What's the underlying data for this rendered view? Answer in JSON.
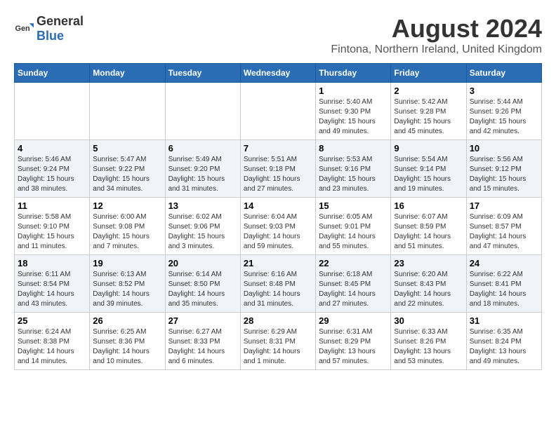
{
  "header": {
    "logo_general": "General",
    "logo_blue": "Blue",
    "main_title": "August 2024",
    "subtitle": "Fintona, Northern Ireland, United Kingdom"
  },
  "days_of_week": [
    "Sunday",
    "Monday",
    "Tuesday",
    "Wednesday",
    "Thursday",
    "Friday",
    "Saturday"
  ],
  "weeks": [
    [
      {
        "day": "",
        "info": ""
      },
      {
        "day": "",
        "info": ""
      },
      {
        "day": "",
        "info": ""
      },
      {
        "day": "",
        "info": ""
      },
      {
        "day": "1",
        "info": "Sunrise: 5:40 AM\nSunset: 9:30 PM\nDaylight: 15 hours\nand 49 minutes."
      },
      {
        "day": "2",
        "info": "Sunrise: 5:42 AM\nSunset: 9:28 PM\nDaylight: 15 hours\nand 45 minutes."
      },
      {
        "day": "3",
        "info": "Sunrise: 5:44 AM\nSunset: 9:26 PM\nDaylight: 15 hours\nand 42 minutes."
      }
    ],
    [
      {
        "day": "4",
        "info": "Sunrise: 5:46 AM\nSunset: 9:24 PM\nDaylight: 15 hours\nand 38 minutes."
      },
      {
        "day": "5",
        "info": "Sunrise: 5:47 AM\nSunset: 9:22 PM\nDaylight: 15 hours\nand 34 minutes."
      },
      {
        "day": "6",
        "info": "Sunrise: 5:49 AM\nSunset: 9:20 PM\nDaylight: 15 hours\nand 31 minutes."
      },
      {
        "day": "7",
        "info": "Sunrise: 5:51 AM\nSunset: 9:18 PM\nDaylight: 15 hours\nand 27 minutes."
      },
      {
        "day": "8",
        "info": "Sunrise: 5:53 AM\nSunset: 9:16 PM\nDaylight: 15 hours\nand 23 minutes."
      },
      {
        "day": "9",
        "info": "Sunrise: 5:54 AM\nSunset: 9:14 PM\nDaylight: 15 hours\nand 19 minutes."
      },
      {
        "day": "10",
        "info": "Sunrise: 5:56 AM\nSunset: 9:12 PM\nDaylight: 15 hours\nand 15 minutes."
      }
    ],
    [
      {
        "day": "11",
        "info": "Sunrise: 5:58 AM\nSunset: 9:10 PM\nDaylight: 15 hours\nand 11 minutes."
      },
      {
        "day": "12",
        "info": "Sunrise: 6:00 AM\nSunset: 9:08 PM\nDaylight: 15 hours\nand 7 minutes."
      },
      {
        "day": "13",
        "info": "Sunrise: 6:02 AM\nSunset: 9:06 PM\nDaylight: 15 hours\nand 3 minutes."
      },
      {
        "day": "14",
        "info": "Sunrise: 6:04 AM\nSunset: 9:03 PM\nDaylight: 14 hours\nand 59 minutes."
      },
      {
        "day": "15",
        "info": "Sunrise: 6:05 AM\nSunset: 9:01 PM\nDaylight: 14 hours\nand 55 minutes."
      },
      {
        "day": "16",
        "info": "Sunrise: 6:07 AM\nSunset: 8:59 PM\nDaylight: 14 hours\nand 51 minutes."
      },
      {
        "day": "17",
        "info": "Sunrise: 6:09 AM\nSunset: 8:57 PM\nDaylight: 14 hours\nand 47 minutes."
      }
    ],
    [
      {
        "day": "18",
        "info": "Sunrise: 6:11 AM\nSunset: 8:54 PM\nDaylight: 14 hours\nand 43 minutes."
      },
      {
        "day": "19",
        "info": "Sunrise: 6:13 AM\nSunset: 8:52 PM\nDaylight: 14 hours\nand 39 minutes."
      },
      {
        "day": "20",
        "info": "Sunrise: 6:14 AM\nSunset: 8:50 PM\nDaylight: 14 hours\nand 35 minutes."
      },
      {
        "day": "21",
        "info": "Sunrise: 6:16 AM\nSunset: 8:48 PM\nDaylight: 14 hours\nand 31 minutes."
      },
      {
        "day": "22",
        "info": "Sunrise: 6:18 AM\nSunset: 8:45 PM\nDaylight: 14 hours\nand 27 minutes."
      },
      {
        "day": "23",
        "info": "Sunrise: 6:20 AM\nSunset: 8:43 PM\nDaylight: 14 hours\nand 22 minutes."
      },
      {
        "day": "24",
        "info": "Sunrise: 6:22 AM\nSunset: 8:41 PM\nDaylight: 14 hours\nand 18 minutes."
      }
    ],
    [
      {
        "day": "25",
        "info": "Sunrise: 6:24 AM\nSunset: 8:38 PM\nDaylight: 14 hours\nand 14 minutes."
      },
      {
        "day": "26",
        "info": "Sunrise: 6:25 AM\nSunset: 8:36 PM\nDaylight: 14 hours\nand 10 minutes."
      },
      {
        "day": "27",
        "info": "Sunrise: 6:27 AM\nSunset: 8:33 PM\nDaylight: 14 hours\nand 6 minutes."
      },
      {
        "day": "28",
        "info": "Sunrise: 6:29 AM\nSunset: 8:31 PM\nDaylight: 14 hours\nand 1 minute."
      },
      {
        "day": "29",
        "info": "Sunrise: 6:31 AM\nSunset: 8:29 PM\nDaylight: 13 hours\nand 57 minutes."
      },
      {
        "day": "30",
        "info": "Sunrise: 6:33 AM\nSunset: 8:26 PM\nDaylight: 13 hours\nand 53 minutes."
      },
      {
        "day": "31",
        "info": "Sunrise: 6:35 AM\nSunset: 8:24 PM\nDaylight: 13 hours\nand 49 minutes."
      }
    ]
  ]
}
